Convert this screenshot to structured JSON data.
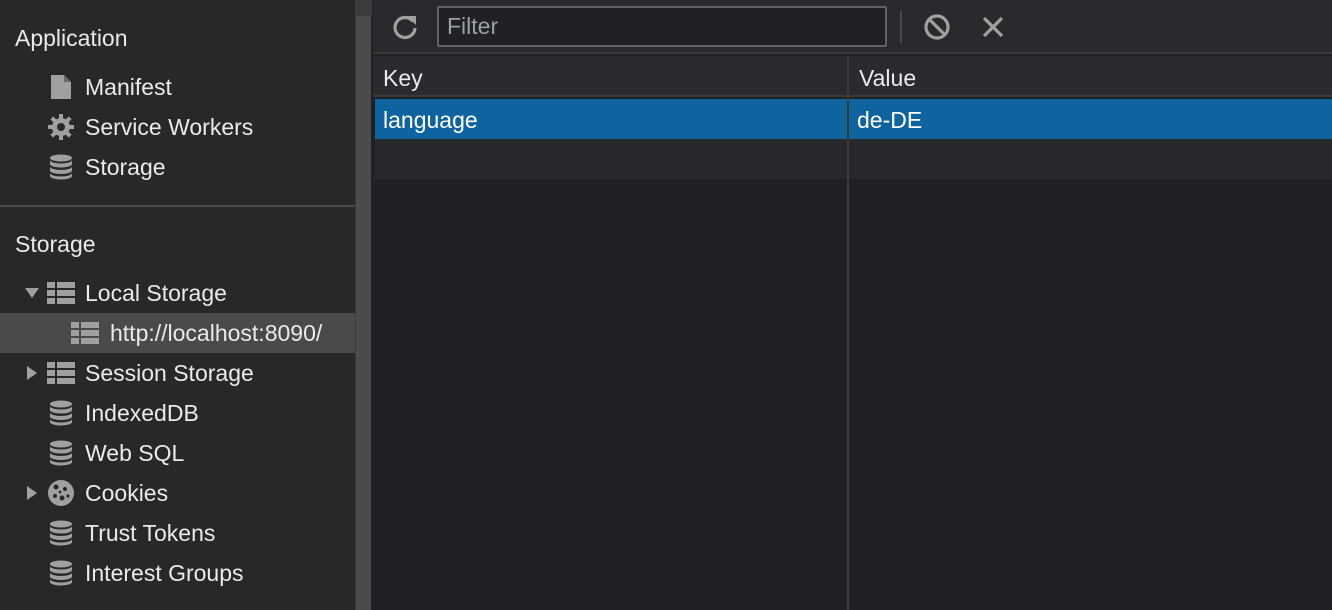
{
  "sidebar": {
    "application_title": "Application",
    "application_items": [
      {
        "label": "Manifest",
        "icon": "file-icon"
      },
      {
        "label": "Service Workers",
        "icon": "gear-icon"
      },
      {
        "label": "Storage",
        "icon": "database-icon"
      }
    ],
    "storage_title": "Storage",
    "storage_items": [
      {
        "label": "Local Storage",
        "icon": "table-icon",
        "expanded": true
      },
      {
        "label": "http://localhost:8090/",
        "icon": "table-icon",
        "selected": true
      },
      {
        "label": "Session Storage",
        "icon": "table-icon",
        "expanded": false
      },
      {
        "label": "IndexedDB",
        "icon": "database-icon"
      },
      {
        "label": "Web SQL",
        "icon": "database-icon"
      },
      {
        "label": "Cookies",
        "icon": "cookie-icon",
        "expanded": false
      },
      {
        "label": "Trust Tokens",
        "icon": "database-icon"
      },
      {
        "label": "Interest Groups",
        "icon": "database-icon"
      }
    ]
  },
  "toolbar": {
    "filter_placeholder": "Filter",
    "refresh_icon": "refresh-icon",
    "clear_all_icon": "block-icon",
    "delete_icon": "close-icon"
  },
  "table": {
    "columns": [
      "Key",
      "Value"
    ],
    "rows": [
      {
        "key": "language",
        "value": "de-DE",
        "selected": true
      }
    ]
  },
  "colors": {
    "selection": "#0f64a0",
    "sidebar_selected": "#4a4a4a",
    "background": "#202124",
    "icon": "#a0a0a0"
  }
}
